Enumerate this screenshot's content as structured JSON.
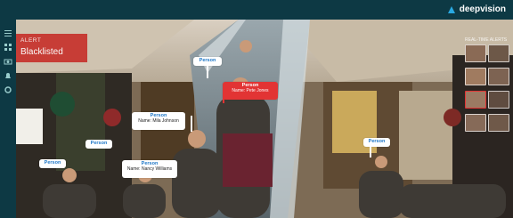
{
  "brand": {
    "name": "deepvision",
    "accent": "#29a9e1"
  },
  "alert": {
    "label": "ALERT",
    "value": "Blacklisted",
    "color": "#c7322c"
  },
  "realtime_panel": {
    "label": "REAL-TIME ALERTS"
  },
  "detections": [
    {
      "type": "Person",
      "name": ""
    },
    {
      "type": "Person",
      "name": "Name: Pete Jones",
      "flagged": true
    },
    {
      "type": "Person",
      "name": "Name: Mila Johnson"
    },
    {
      "type": "Person",
      "name": ""
    },
    {
      "type": "Person",
      "name": ""
    },
    {
      "type": "Person",
      "name": "Name: Nancy Williams"
    },
    {
      "type": "Person",
      "name": ""
    }
  ],
  "icons": {
    "sidebar": [
      "menu-icon",
      "grid-icon",
      "camera-icon",
      "bell-icon",
      "settings-icon"
    ],
    "logo": "deepvision-logo-icon"
  }
}
